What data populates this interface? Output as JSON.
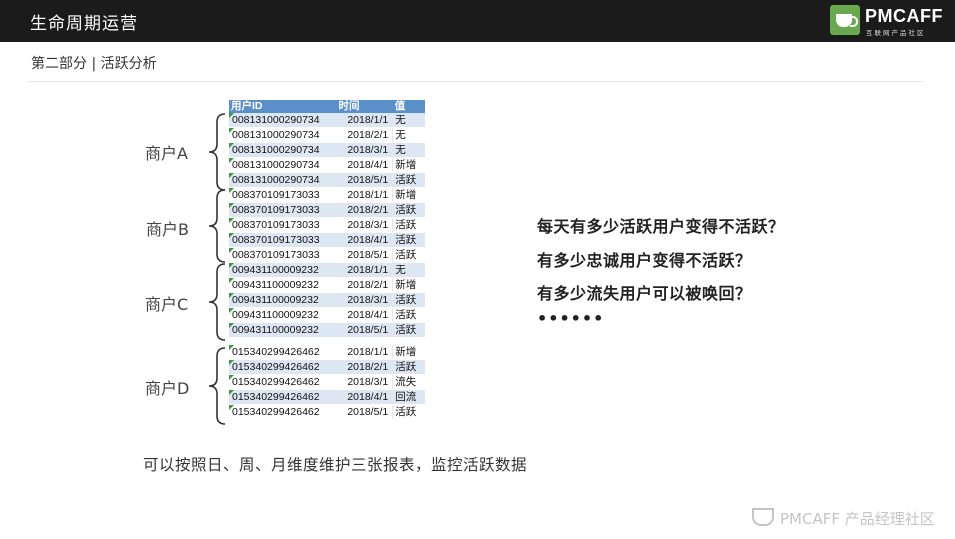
{
  "header": {
    "title": "生命周期运营",
    "logo_brand": "PMCAFF",
    "logo_sub": "互联网产品社区"
  },
  "section_title": "第二部分 | 活跃分析",
  "table": {
    "columns": [
      "用户ID",
      "时间",
      "值"
    ],
    "groups": [
      {
        "rows": [
          [
            "008131000290734",
            "2018/1/1",
            "无"
          ],
          [
            "008131000290734",
            "2018/2/1",
            "无"
          ],
          [
            "008131000290734",
            "2018/3/1",
            "无"
          ],
          [
            "008131000290734",
            "2018/4/1",
            "新增"
          ],
          [
            "008131000290734",
            "2018/5/1",
            "活跃"
          ]
        ]
      },
      {
        "rows": [
          [
            "008370109173033",
            "2018/1/1",
            "新增"
          ],
          [
            "008370109173033",
            "2018/2/1",
            "活跃"
          ],
          [
            "008370109173033",
            "2018/3/1",
            "活跃"
          ],
          [
            "008370109173033",
            "2018/4/1",
            "活跃"
          ],
          [
            "008370109173033",
            "2018/5/1",
            "活跃"
          ]
        ]
      },
      {
        "rows": [
          [
            "009431100009232",
            "2018/1/1",
            "无"
          ],
          [
            "009431100009232",
            "2018/2/1",
            "新增"
          ],
          [
            "009431100009232",
            "2018/3/1",
            "活跃"
          ],
          [
            "009431100009232",
            "2018/4/1",
            "活跃"
          ],
          [
            "009431100009232",
            "2018/5/1",
            "活跃"
          ]
        ]
      },
      {
        "rows": [
          [
            "015340299426462",
            "2018/1/1",
            "新增"
          ],
          [
            "015340299426462",
            "2018/2/1",
            "活跃"
          ],
          [
            "015340299426462",
            "2018/3/1",
            "流失"
          ],
          [
            "015340299426462",
            "2018/4/1",
            "回流"
          ],
          [
            "015340299426462",
            "2018/5/1",
            "活跃"
          ]
        ]
      }
    ]
  },
  "merchants": [
    "商户A",
    "商户B",
    "商户C",
    "商户D"
  ],
  "questions": [
    "每天有多少活跃用户变得不活跃？",
    "有多少忠诚用户变得不活跃？",
    "有多少流失用户可以被唤回？"
  ],
  "ellipsis": "••••••",
  "bottom_note": "可以按照日、周、月维度维护三张报表，监控活跃数据",
  "watermark": "PMCAFF 产品经理社区",
  "colors": {
    "header_bg": "#1b1b1b",
    "table_header": "#5b8fc9",
    "row_band": "#dde7f3",
    "logo_green": "#6aa84f"
  }
}
